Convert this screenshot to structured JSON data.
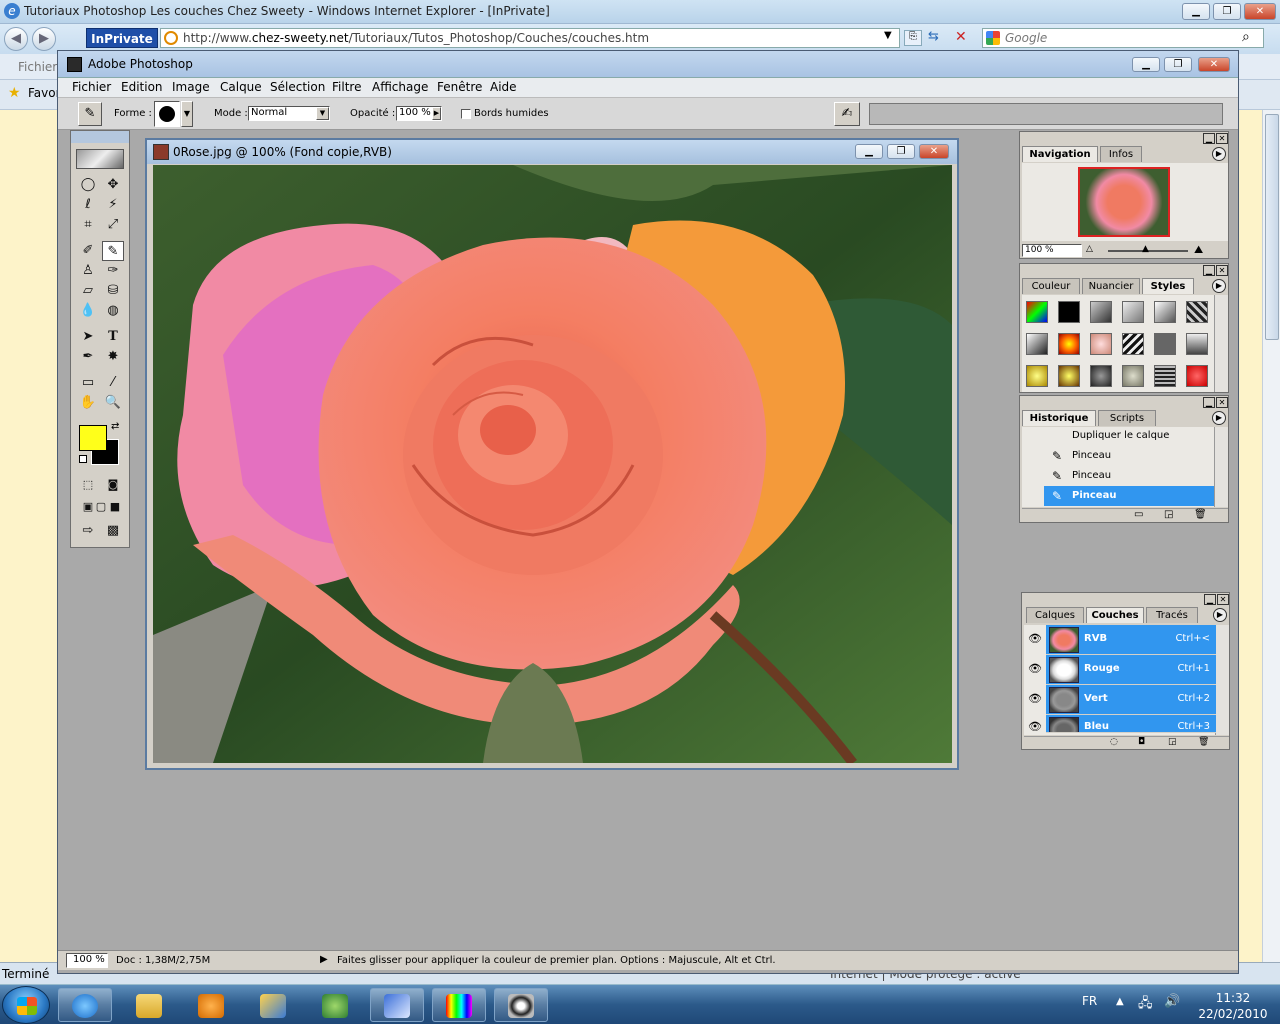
{
  "ie": {
    "title": "Tutoriaux Photoshop Les couches Chez Sweety - Windows Internet Explorer - [InPrivate]",
    "inprivate": "InPrivate",
    "url_prefix": "http://www.",
    "url_domain": "chez-sweety.net",
    "url_rest": "/Tutoriaux/Tutos_Photoshop/Couches/couches.htm",
    "search_placeholder": "Google",
    "menu_partial": "Fichier",
    "fav_partial": "Favor",
    "status": "Terminé",
    "status_right": "Internet | Mode protégé : activé"
  },
  "ps": {
    "title": "Adobe Photoshop",
    "menu": [
      "Fichier",
      "Edition",
      "Image",
      "Calque",
      "Sélection",
      "Filtre",
      "Affichage",
      "Fenêtre",
      "Aide"
    ],
    "options": {
      "forme_label": "Forme :",
      "mode_label": "Mode :",
      "mode_value": "Normal",
      "opacity_label": "Opacité :",
      "opacity_value": "100 %",
      "wet_edges": "Bords humides"
    },
    "document": {
      "title": "0Rose.jpg @ 100% (Fond copie,RVB)"
    },
    "navigator": {
      "tabs": [
        "Navigation",
        "Infos"
      ],
      "zoom": "100 %"
    },
    "styles": {
      "tabs": [
        "Couleur",
        "Nuancier",
        "Styles"
      ]
    },
    "history": {
      "tabs": [
        "Historique",
        "Scripts"
      ],
      "items": [
        "Dupliquer le calque",
        "Pinceau",
        "Pinceau",
        "Pinceau"
      ]
    },
    "channels": {
      "tabs": [
        "Calques",
        "Couches",
        "Tracés"
      ],
      "items": [
        {
          "name": "RVB",
          "shortcut": "Ctrl+<"
        },
        {
          "name": "Rouge",
          "shortcut": "Ctrl+1"
        },
        {
          "name": "Vert",
          "shortcut": "Ctrl+2"
        },
        {
          "name": "Bleu",
          "shortcut": "Ctrl+3"
        }
      ]
    },
    "status": {
      "zoom": "100 %",
      "doc": "Doc : 1,38M/2,75M",
      "hint": "Faites glisser pour appliquer la couleur de premier plan. Options : Majuscule, Alt et Ctrl."
    },
    "colors": {
      "foreground": "#ffff1a",
      "background": "#000000",
      "selection": "#3196ef"
    }
  },
  "taskbar": {
    "lang": "FR",
    "time": "11:32",
    "date": "22/02/2010"
  }
}
